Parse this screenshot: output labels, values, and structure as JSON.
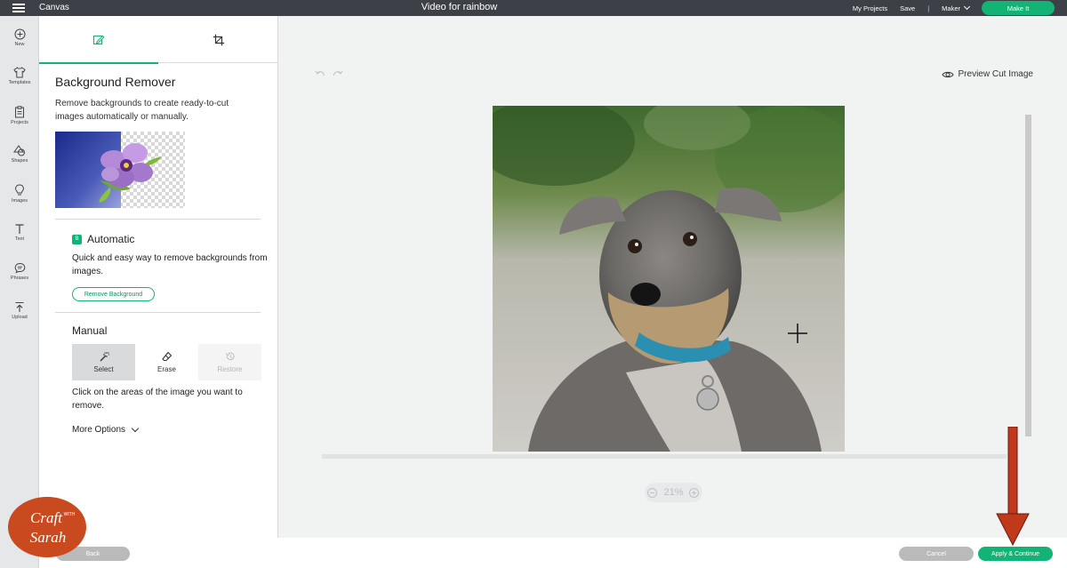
{
  "topbar": {
    "app_name": "Canvas",
    "doc_title": "Video for rainbow",
    "my_projects": "My Projects",
    "save": "Save",
    "separator": "|",
    "machine": "Maker",
    "make_it": "Make It"
  },
  "leftbar": {
    "items": [
      {
        "label": "New",
        "icon": "plus-circle-icon"
      },
      {
        "label": "Templates",
        "icon": "shirt-icon"
      },
      {
        "label": "Projects",
        "icon": "clipboard-icon"
      },
      {
        "label": "Shapes",
        "icon": "shapes-icon"
      },
      {
        "label": "Images",
        "icon": "bulb-icon"
      },
      {
        "label": "Text",
        "icon": "text-icon"
      },
      {
        "label": "Phrases",
        "icon": "speech-bubble-icon"
      },
      {
        "label": "Upload",
        "icon": "upload-icon"
      }
    ]
  },
  "panel": {
    "title": "Background Remover",
    "description": "Remove backgrounds to create ready-to-cut images automatically or manually.",
    "automatic": {
      "badge": "B",
      "title": "Automatic",
      "description": "Quick and easy way to remove backgrounds from images.",
      "button": "Remove Background"
    },
    "manual": {
      "title": "Manual",
      "tools": [
        {
          "label": "Select",
          "state": "active"
        },
        {
          "label": "Erase",
          "state": "normal"
        },
        {
          "label": "Restore",
          "state": "disabled"
        }
      ],
      "description": "Click on the areas of the image you want to remove.",
      "more_options": "More Options"
    }
  },
  "canvas": {
    "preview_label": "Preview Cut Image",
    "zoom": "21%"
  },
  "bottombar": {
    "back": "Back",
    "cancel": "Cancel",
    "apply": "Apply & Continue"
  },
  "watermark": {
    "text": "Craft with Sarah"
  },
  "colors": {
    "accent": "#13b375",
    "topbar": "#3d4047",
    "arrow": "#c0391b"
  }
}
